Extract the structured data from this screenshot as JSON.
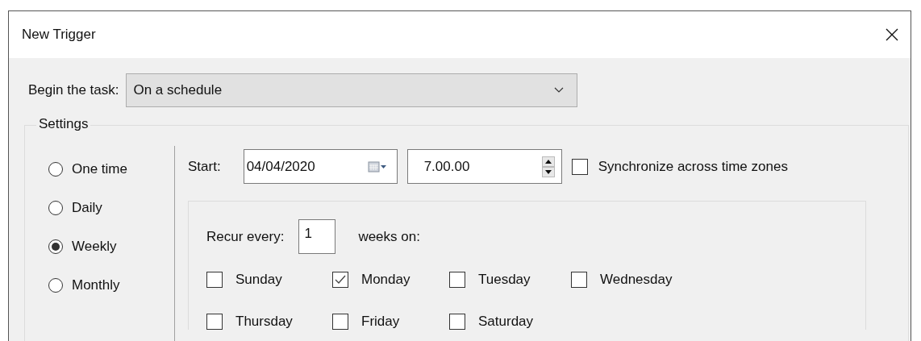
{
  "window": {
    "title": "New Trigger"
  },
  "begin": {
    "label": "Begin the task:",
    "value": "On a schedule"
  },
  "settings": {
    "title": "Settings",
    "schedules": [
      {
        "label": "One time",
        "selected": false
      },
      {
        "label": "Daily",
        "selected": false
      },
      {
        "label": "Weekly",
        "selected": true
      },
      {
        "label": "Monthly",
        "selected": false
      }
    ],
    "start": {
      "label": "Start:",
      "date": "04/04/2020",
      "time": "7.00.00"
    },
    "sync": {
      "label": "Synchronize across time zones",
      "checked": false
    },
    "recur": {
      "label": "Recur every:",
      "value": "1",
      "unit": "weeks on:"
    },
    "days": [
      {
        "label": "Sunday",
        "checked": false
      },
      {
        "label": "Monday",
        "checked": true
      },
      {
        "label": "Tuesday",
        "checked": false
      },
      {
        "label": "Wednesday",
        "checked": false
      },
      {
        "label": "Thursday",
        "checked": false
      },
      {
        "label": "Friday",
        "checked": false
      },
      {
        "label": "Saturday",
        "checked": false
      }
    ]
  }
}
